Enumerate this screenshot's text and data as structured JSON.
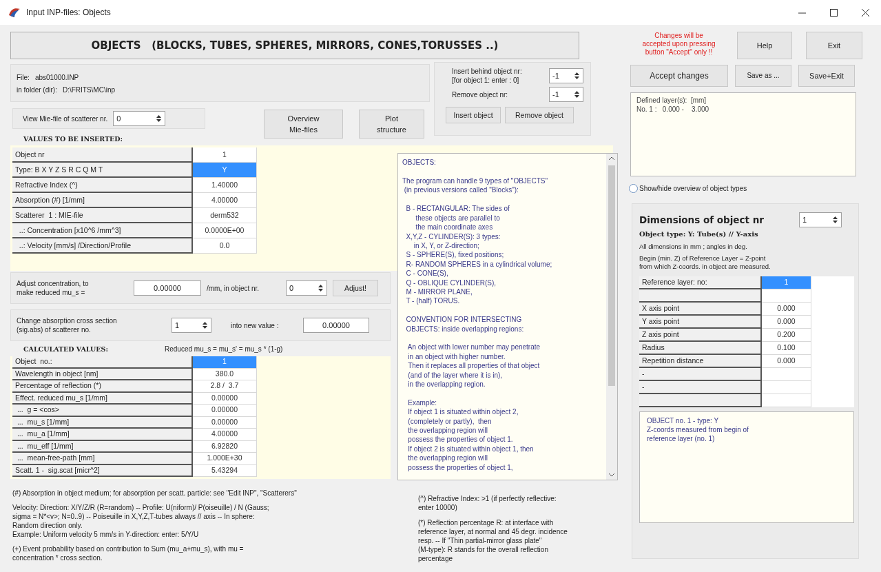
{
  "window": {
    "title": "Input INP-files: Objects"
  },
  "heading": "OBJECTS   (BLOCKS, TUBES, SPHERES, MIRRORS, CONES,TORUSSES ..)",
  "file": {
    "file_label": "File:",
    "file_name": "abs01000.INP",
    "folder_label": "in folder (dir):",
    "folder": "D:\\FRITS\\MC\\inp"
  },
  "view_mie": {
    "label": "View Mie-file of scatterer nr.",
    "value": "0"
  },
  "overview_button": "Overview\nMie-files",
  "plot_button": "Plot\nstructure",
  "insert_panel": {
    "insert_label": "Insert behind object nr:\n[for object 1: enter : 0]",
    "insert_value": "-1",
    "remove_label": "Remove object nr:",
    "remove_value": "-1",
    "insert_button": "Insert object",
    "remove_button": "Remove object"
  },
  "values_title": "VALUES TO BE INSERTED:",
  "values_table": [
    {
      "label": "Object nr",
      "value": "1",
      "selected": false
    },
    {
      "label": "Type: B X Y Z S R C Q M T",
      "value": "Y",
      "selected": true
    },
    {
      "label": "Refractive Index (^)",
      "value": "1.40000",
      "selected": false
    },
    {
      "label": "Absorption (#) [1/mm]",
      "value": "4.00000",
      "selected": false
    },
    {
      "label": "Scatterer  1 : MIE-file",
      "value": "derm532",
      "selected": false
    },
    {
      "label": "  ..: Concentration [x10^6 /mm^3]",
      "value": "0.0000E+00",
      "selected": false
    },
    {
      "label": "  ..: Velocity [mm/s] /Direction/Profile",
      "value": "0.0",
      "selected": false
    }
  ],
  "adjust": {
    "label": "Adjust concentration, to\nmake reduced mu_s =",
    "value": "0.00000",
    "unit": "/mm, in object nr.",
    "object_value": "0",
    "button": "Adjust!"
  },
  "change_abs": {
    "label": "Change absorption cross section\n(sig.abs) of scatterer no.",
    "scatterer": "1",
    "into_label": "into new value :",
    "value": "0.00000"
  },
  "calc": {
    "title": "CALCULATED VALUES:",
    "formula": "Reduced mu_s = mu_s' = mu_s * (1-g)",
    "rows": [
      {
        "label": "Object  no.:",
        "value": "1",
        "selected": true
      },
      {
        "label": "Wavelength in object [nm]",
        "value": "380.0",
        "selected": false
      },
      {
        "label": "Percentage of reflection (*)",
        "value": "2.8 /  3.7",
        "selected": false
      },
      {
        "label": "Effect. reduced mu_s [1/mm]",
        "value": "0.00000",
        "selected": false
      },
      {
        "label": " ...  g = <cos>",
        "value": "0.00000",
        "selected": false
      },
      {
        "label": " ...  mu_s [1/mm]",
        "value": "0.00000",
        "selected": false
      },
      {
        "label": " ...  mu_a [1/mm]",
        "value": "4.00000",
        "selected": false
      },
      {
        "label": " ...  mu_eff [1/mm]",
        "value": "6.92820",
        "selected": false
      },
      {
        "label": " ...  mean-free-path [mm]",
        "value": "1.000E+30",
        "selected": false
      },
      {
        "label": "Scatt. 1 -  sig.scat [micr^2]",
        "value": "5.43294",
        "selected": false
      }
    ]
  },
  "help_text": "OBJECTS:\n\nThe program can handle 9 types of \"OBJECTS\"\n (in previous versions called \"Blocks\"):\n\n  B - RECTANGULAR: The sides of\n       these objects are parallel to\n       the main coordinate axes\n  X,Y,Z - CYLINDER(S): 3 types:\n      in X, Y, or Z-direction;\n  S - SPHERE(S), fixed positions;\n  R- RANDOM SPHERES in a cylindrical volume;\n  C - CONE(S),\n  Q - OBLIQUE CYLINDER(S),\n  M - MIRROR PLANE,\n  T - (half) TORUS.\n\n  CONVENTION FOR INTERSECTING\n  OBJECTS: inside overlapping regions:\n\n   An object with lower number may penetrate\n   in an object with higher number.\n   Then it replaces all properties of that object\n   (and of the layer where it is in),\n   in the overlapping region.\n\n   Example:\n   If object 1 is situated within object 2,\n   (completely or partly),  then\n   the overlapping region will\n   possess the properties of object 1.\n   If object 2 is situated within object 1, then\n   the overlapping region will\n   possess the properties of object 1,",
  "notes_left": [
    "(#) Absorption in object medium; for absorption per scatt. particle: see \"Edit INP\", \"Scatterers\"",
    "Velocity: Direction: X/Y/Z/R (R=random)  -- Profile: U(niform)/ P(oiseuille) / N (Gauss;\nsigma = N*<v>; N=0..9)  --  Poiseuille in X,Y,Z,T-tubes always // axis  -- In sphere:\nRandom direction only.\nExample: Uniform velocity 5 mm/s in Y-direction: enter: 5/Y/U",
    "(+) Event probability based on contribution to Sum (mu_a+mu_s), with mu =\nconcentration * cross section."
  ],
  "notes_middle": [
    "(^) Refractive Index: >1 (if perfectly reflective:\nenter 10000)",
    "(*) Reflection percentage R: at interface with\nreference layer, at normal and 45 degr. incidence\nresp.  -- If \"Thin partial-mirror glass plate\"\n(M-type): R stands for the overall reflection\npercentage"
  ],
  "warning": "Changes will be\naccepted upon pressing\nbutton \"Accept\" only !!",
  "help_button": "Help",
  "exit_button": "Exit",
  "accept_button": "Accept changes",
  "save_as_button": "Save as ...",
  "save_exit_button": "Save+Exit",
  "layers_text": "Defined layer(s):  [mm]\nNo. 1 :   0.000 -    3.000",
  "overview_radio": {
    "label": "Show/hide overview of object types",
    "selected": false
  },
  "dimensions": {
    "title": "Dimensions of object nr",
    "value": "1",
    "type": "Object type: Y: Tube(s) // Y-axis",
    "units": "All dimensions in mm ; angles in deg.",
    "begin": "Begin (min. Z) of Reference Layer =    Z-point\nfrom which Z-coords. in object are measured.",
    "rows": [
      {
        "label": "Reference layer: no:",
        "value": "1",
        "selected": true
      },
      {
        "label": "",
        "value": "",
        "selected": false
      },
      {
        "label": "X axis point",
        "value": "0.000",
        "selected": false
      },
      {
        "label": "Y axis point",
        "value": "0.000",
        "selected": false
      },
      {
        "label": "Z axis point",
        "value": "0.200",
        "selected": false
      },
      {
        "label": "Radius",
        "value": "0.100",
        "selected": false
      },
      {
        "label": "Repetition distance",
        "value": "0.000",
        "selected": false
      },
      {
        "label": "-",
        "value": "",
        "selected": false
      },
      {
        "label": "-",
        "value": "",
        "selected": false
      },
      {
        "label": "",
        "value": "",
        "selected": false
      }
    ],
    "info": "OBJECT no. 1 - type: Y\nZ-coords measured from begin of\nreference layer (no. 1)"
  }
}
